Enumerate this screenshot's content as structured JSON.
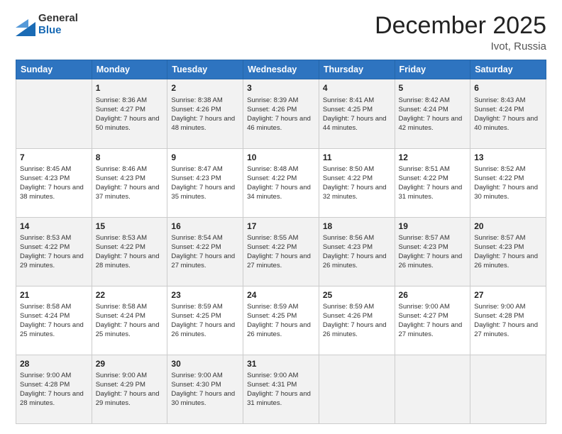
{
  "logo": {
    "general": "General",
    "blue": "Blue"
  },
  "title": "December 2025",
  "location": "Ivot, Russia",
  "days_of_week": [
    "Sunday",
    "Monday",
    "Tuesday",
    "Wednesday",
    "Thursday",
    "Friday",
    "Saturday"
  ],
  "weeks": [
    [
      {
        "day": "",
        "sunrise": "",
        "sunset": "",
        "daylight": ""
      },
      {
        "day": "1",
        "sunrise": "Sunrise: 8:36 AM",
        "sunset": "Sunset: 4:27 PM",
        "daylight": "Daylight: 7 hours and 50 minutes."
      },
      {
        "day": "2",
        "sunrise": "Sunrise: 8:38 AM",
        "sunset": "Sunset: 4:26 PM",
        "daylight": "Daylight: 7 hours and 48 minutes."
      },
      {
        "day": "3",
        "sunrise": "Sunrise: 8:39 AM",
        "sunset": "Sunset: 4:26 PM",
        "daylight": "Daylight: 7 hours and 46 minutes."
      },
      {
        "day": "4",
        "sunrise": "Sunrise: 8:41 AM",
        "sunset": "Sunset: 4:25 PM",
        "daylight": "Daylight: 7 hours and 44 minutes."
      },
      {
        "day": "5",
        "sunrise": "Sunrise: 8:42 AM",
        "sunset": "Sunset: 4:24 PM",
        "daylight": "Daylight: 7 hours and 42 minutes."
      },
      {
        "day": "6",
        "sunrise": "Sunrise: 8:43 AM",
        "sunset": "Sunset: 4:24 PM",
        "daylight": "Daylight: 7 hours and 40 minutes."
      }
    ],
    [
      {
        "day": "7",
        "sunrise": "Sunrise: 8:45 AM",
        "sunset": "Sunset: 4:23 PM",
        "daylight": "Daylight: 7 hours and 38 minutes."
      },
      {
        "day": "8",
        "sunrise": "Sunrise: 8:46 AM",
        "sunset": "Sunset: 4:23 PM",
        "daylight": "Daylight: 7 hours and 37 minutes."
      },
      {
        "day": "9",
        "sunrise": "Sunrise: 8:47 AM",
        "sunset": "Sunset: 4:23 PM",
        "daylight": "Daylight: 7 hours and 35 minutes."
      },
      {
        "day": "10",
        "sunrise": "Sunrise: 8:48 AM",
        "sunset": "Sunset: 4:22 PM",
        "daylight": "Daylight: 7 hours and 34 minutes."
      },
      {
        "day": "11",
        "sunrise": "Sunrise: 8:50 AM",
        "sunset": "Sunset: 4:22 PM",
        "daylight": "Daylight: 7 hours and 32 minutes."
      },
      {
        "day": "12",
        "sunrise": "Sunrise: 8:51 AM",
        "sunset": "Sunset: 4:22 PM",
        "daylight": "Daylight: 7 hours and 31 minutes."
      },
      {
        "day": "13",
        "sunrise": "Sunrise: 8:52 AM",
        "sunset": "Sunset: 4:22 PM",
        "daylight": "Daylight: 7 hours and 30 minutes."
      }
    ],
    [
      {
        "day": "14",
        "sunrise": "Sunrise: 8:53 AM",
        "sunset": "Sunset: 4:22 PM",
        "daylight": "Daylight: 7 hours and 29 minutes."
      },
      {
        "day": "15",
        "sunrise": "Sunrise: 8:53 AM",
        "sunset": "Sunset: 4:22 PM",
        "daylight": "Daylight: 7 hours and 28 minutes."
      },
      {
        "day": "16",
        "sunrise": "Sunrise: 8:54 AM",
        "sunset": "Sunset: 4:22 PM",
        "daylight": "Daylight: 7 hours and 27 minutes."
      },
      {
        "day": "17",
        "sunrise": "Sunrise: 8:55 AM",
        "sunset": "Sunset: 4:22 PM",
        "daylight": "Daylight: 7 hours and 27 minutes."
      },
      {
        "day": "18",
        "sunrise": "Sunrise: 8:56 AM",
        "sunset": "Sunset: 4:23 PM",
        "daylight": "Daylight: 7 hours and 26 minutes."
      },
      {
        "day": "19",
        "sunrise": "Sunrise: 8:57 AM",
        "sunset": "Sunset: 4:23 PM",
        "daylight": "Daylight: 7 hours and 26 minutes."
      },
      {
        "day": "20",
        "sunrise": "Sunrise: 8:57 AM",
        "sunset": "Sunset: 4:23 PM",
        "daylight": "Daylight: 7 hours and 26 minutes."
      }
    ],
    [
      {
        "day": "21",
        "sunrise": "Sunrise: 8:58 AM",
        "sunset": "Sunset: 4:24 PM",
        "daylight": "Daylight: 7 hours and 25 minutes."
      },
      {
        "day": "22",
        "sunrise": "Sunrise: 8:58 AM",
        "sunset": "Sunset: 4:24 PM",
        "daylight": "Daylight: 7 hours and 25 minutes."
      },
      {
        "day": "23",
        "sunrise": "Sunrise: 8:59 AM",
        "sunset": "Sunset: 4:25 PM",
        "daylight": "Daylight: 7 hours and 26 minutes."
      },
      {
        "day": "24",
        "sunrise": "Sunrise: 8:59 AM",
        "sunset": "Sunset: 4:25 PM",
        "daylight": "Daylight: 7 hours and 26 minutes."
      },
      {
        "day": "25",
        "sunrise": "Sunrise: 8:59 AM",
        "sunset": "Sunset: 4:26 PM",
        "daylight": "Daylight: 7 hours and 26 minutes."
      },
      {
        "day": "26",
        "sunrise": "Sunrise: 9:00 AM",
        "sunset": "Sunset: 4:27 PM",
        "daylight": "Daylight: 7 hours and 27 minutes."
      },
      {
        "day": "27",
        "sunrise": "Sunrise: 9:00 AM",
        "sunset": "Sunset: 4:28 PM",
        "daylight": "Daylight: 7 hours and 27 minutes."
      }
    ],
    [
      {
        "day": "28",
        "sunrise": "Sunrise: 9:00 AM",
        "sunset": "Sunset: 4:28 PM",
        "daylight": "Daylight: 7 hours and 28 minutes."
      },
      {
        "day": "29",
        "sunrise": "Sunrise: 9:00 AM",
        "sunset": "Sunset: 4:29 PM",
        "daylight": "Daylight: 7 hours and 29 minutes."
      },
      {
        "day": "30",
        "sunrise": "Sunrise: 9:00 AM",
        "sunset": "Sunset: 4:30 PM",
        "daylight": "Daylight: 7 hours and 30 minutes."
      },
      {
        "day": "31",
        "sunrise": "Sunrise: 9:00 AM",
        "sunset": "Sunset: 4:31 PM",
        "daylight": "Daylight: 7 hours and 31 minutes."
      },
      {
        "day": "",
        "sunrise": "",
        "sunset": "",
        "daylight": ""
      },
      {
        "day": "",
        "sunrise": "",
        "sunset": "",
        "daylight": ""
      },
      {
        "day": "",
        "sunrise": "",
        "sunset": "",
        "daylight": ""
      }
    ]
  ]
}
